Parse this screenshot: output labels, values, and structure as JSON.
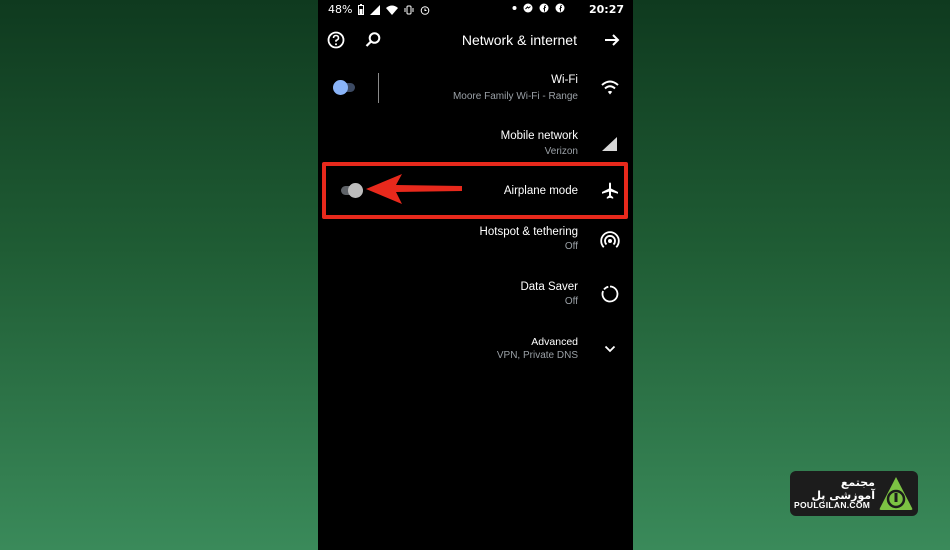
{
  "status_bar": {
    "time": "20:27",
    "battery": "48%",
    "left_icons": [
      "battery-icon",
      "signal-icon",
      "wifi-icon",
      "vibrate-icon",
      "alarm-icon"
    ],
    "right_icons": [
      "dot-icon",
      "messenger-icon",
      "facebook-icon",
      "facebook-icon"
    ]
  },
  "toolbar": {
    "title": "Network & internet",
    "back_icon": "arrow-back-icon",
    "search_icon": "search-icon",
    "help_icon": "help-icon"
  },
  "settings": [
    {
      "title": "Wi-Fi",
      "subtitle": "Moore Family Wi-Fi - Range",
      "icon": "wifi-icon",
      "toggle": true,
      "on": true
    },
    {
      "title": "Mobile network",
      "subtitle": "Verizon",
      "icon": "signal-icon",
      "toggle": false
    },
    {
      "title": "Airplane mode",
      "subtitle": "",
      "icon": "airplane-icon",
      "toggle": true,
      "on": false
    },
    {
      "title": "Hotspot & tethering",
      "subtitle": "Off",
      "icon": "hotspot-icon",
      "toggle": false
    },
    {
      "title": "Data Saver",
      "subtitle": "Off",
      "icon": "data-saver-icon",
      "toggle": false
    },
    {
      "title": "Advanced",
      "subtitle": "VPN, Private DNS",
      "icon": "chevron-down-icon",
      "toggle": false
    }
  ],
  "logo": {
    "name_fa": "مجتمع آموزشی پل",
    "domain": "POULGILAN.COM"
  },
  "colors": {
    "highlight": "#e8291c",
    "toggle_on_knob": "#8ab4f8",
    "toggle_on_track": "#3c4a63",
    "toggle_off_knob": "#bdbdbd",
    "toggle_off_track": "#5f6368",
    "logo_green": "#7cc243"
  }
}
